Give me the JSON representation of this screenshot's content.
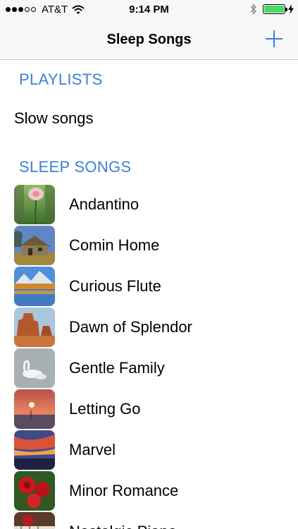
{
  "status_bar": {
    "carrier": "AT&T",
    "time": "9:14 PM",
    "signal_bars_filled": 3,
    "signal_bars_total": 5,
    "battery_level": 1.0,
    "icons": [
      "wifi-icon",
      "bluetooth-icon",
      "battery-icon",
      "charging-bolt-icon"
    ]
  },
  "nav": {
    "title": "Sleep Songs",
    "add_icon": "plus-icon"
  },
  "colors": {
    "accent": "#3e7fd6",
    "battery_green": "#4cd964"
  },
  "sections": {
    "playlists_header": "PLAYLISTS",
    "playlists": [
      {
        "label": "Slow songs"
      }
    ],
    "songs_header": "SLEEP SONGS",
    "songs": [
      {
        "title": "Andantino",
        "thumb": "pink-flower-icon"
      },
      {
        "title": "Comin Home",
        "thumb": "old-house-icon"
      },
      {
        "title": "Curious Flute",
        "thumb": "mountain-lake-icon"
      },
      {
        "title": "Dawn of Splendor",
        "thumb": "desert-butte-icon"
      },
      {
        "title": "Gentle Family",
        "thumb": "swans-icon"
      },
      {
        "title": "Letting Go",
        "thumb": "sunset-boat-icon"
      },
      {
        "title": "Marvel",
        "thumb": "red-sky-sunset-icon"
      },
      {
        "title": "Minor Romance",
        "thumb": "red-roses-icon"
      },
      {
        "title": "Nostalgic Piano",
        "thumb": "piano-rose-icon"
      }
    ]
  }
}
